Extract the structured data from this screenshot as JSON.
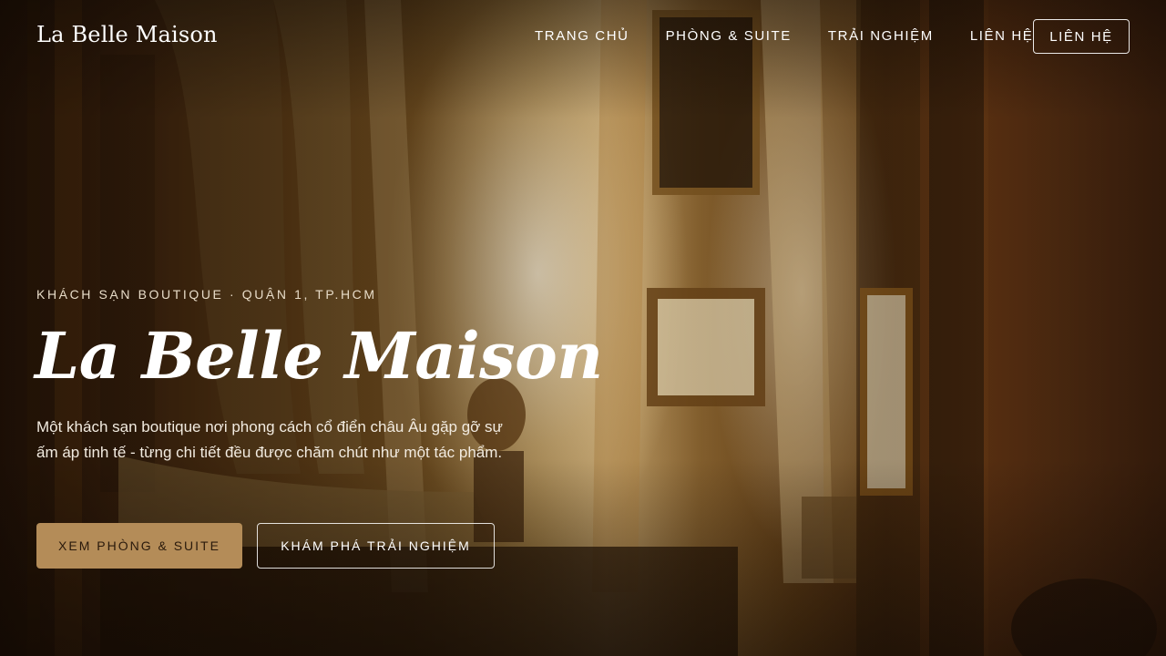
{
  "header": {
    "logo": "La Belle Maison",
    "nav": [
      {
        "label": "TRANG CHỦ"
      },
      {
        "label": "PHÒNG & SUITE"
      },
      {
        "label": "TRẢI NGHIỆM"
      },
      {
        "label": "LIÊN HỆ"
      }
    ],
    "cta_label": "LIÊN HỆ"
  },
  "hero": {
    "eyebrow": "KHÁCH SẠN BOUTIQUE · QUẬN 1, TP.HCM",
    "title": "La Belle Maison",
    "description": "Một khách sạn boutique nơi phong cách cổ điển châu Âu gặp gỡ sự ấm áp tinh tế - từng chi tiết đều được chăm chút như một tác phẩm.",
    "primary_button": "XEM PHÒNG & SUITE",
    "secondary_button": "KHÁM PHÁ TRẢI NGHIỆM",
    "background_image": "ornate-bedroom-with-curtains"
  },
  "colors": {
    "accent": "#b48c58",
    "text": "#ffffff"
  }
}
